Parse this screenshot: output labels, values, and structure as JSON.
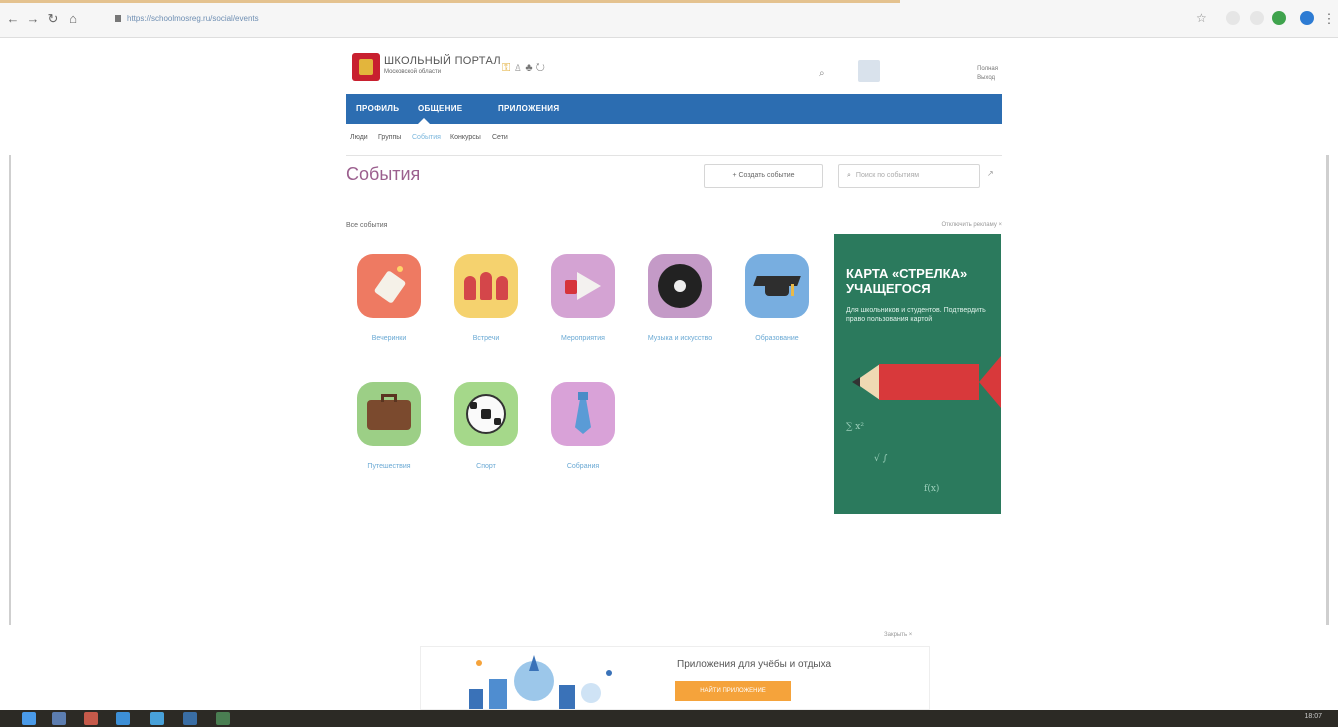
{
  "browser": {
    "back_icon": "back-arrow-icon",
    "forward_icon": "forward-arrow-icon",
    "reload_icon": "reload-icon",
    "home_icon": "home-icon",
    "url": "https://schoolmosreg.ru/social/events"
  },
  "header": {
    "logo_title": "ШКОЛЬНЫЙ ПОРТАЛ",
    "logo_subtitle": "Московской области",
    "profile_link": "Полная",
    "logout_link": "Выход"
  },
  "main_nav": {
    "items": [
      {
        "label": "ПРОФИЛЬ"
      },
      {
        "label": "ОБЩЕНИЕ"
      },
      {
        "label": "ПРИЛОЖЕНИЯ"
      }
    ],
    "active_index": 1
  },
  "sub_nav": {
    "items": [
      {
        "label": "Люди"
      },
      {
        "label": "Группы"
      },
      {
        "label": "События"
      },
      {
        "label": "Конкурсы"
      },
      {
        "label": "Сети"
      }
    ],
    "active_index": 2
  },
  "events": {
    "title": "События",
    "create_button": "+ Создать событие",
    "search_placeholder": "Поиск по событиям",
    "section_label": "Все события",
    "disable_ads": "Отключить рекламу ×",
    "categories": [
      {
        "label": "Вечеринки",
        "color": "#ee7a62",
        "icon": "party-popper-icon"
      },
      {
        "label": "Встречи",
        "color": "#f5d26e",
        "icon": "people-icon"
      },
      {
        "label": "Мероприятия",
        "color": "#d4a3d3",
        "icon": "megaphone-icon"
      },
      {
        "label": "Музыка и искусство",
        "color": "#c49ac7",
        "icon": "vinyl-record-icon"
      },
      {
        "label": "Образование",
        "color": "#78aee0",
        "icon": "graduation-cap-icon"
      },
      {
        "label": "Путешествия",
        "color": "#9ccf86",
        "icon": "suitcase-icon"
      },
      {
        "label": "Спорт",
        "color": "#a5d88a",
        "icon": "soccer-ball-icon"
      },
      {
        "label": "Собрания",
        "color": "#d9a2d8",
        "icon": "necktie-icon"
      }
    ]
  },
  "ad": {
    "headline_line1": "КАРТА «СТРЕЛКА»",
    "headline_line2": "УЧАЩЕГОСЯ",
    "text": "Для школьников и студентов. Подтвердить право пользования картой"
  },
  "bottom_banner": {
    "close_label": "Закрыть ×",
    "title": "Приложения для учёбы и отдыха",
    "button": "НАЙТИ ПРИЛОЖЕНИЕ"
  },
  "taskbar": {
    "clock": "18:07"
  }
}
